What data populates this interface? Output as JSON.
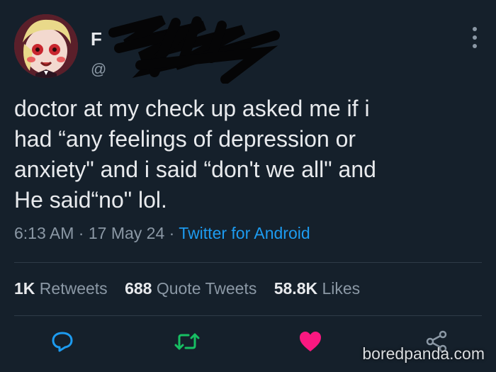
{
  "user": {
    "display_name": "F",
    "handle": "@"
  },
  "tweet": {
    "text": "doctor at my check up asked me if i\nhad “any feelings of depression or\nanxiety\" and i said “don't we all\" and\nHe said“no\" lol.",
    "time": "6:13 AM",
    "separator": "·",
    "date": "17 May 24",
    "source": "Twitter for Android"
  },
  "stats": {
    "retweets_count": "1K",
    "retweets_label": "Retweets",
    "quotes_count": "688",
    "quotes_label": "Quote Tweets",
    "likes_count": "58.8K",
    "likes_label": "Likes"
  },
  "colors": {
    "background": "#15202b",
    "accent": "#1d9bf0",
    "retweet": "#17bf63",
    "like": "#f91880",
    "muted": "#8b98a5"
  },
  "icons": {
    "reply": "reply-icon",
    "retweet": "retweet-icon",
    "like": "heart-icon",
    "share": "share-icon",
    "more": "more-icon"
  },
  "watermark": "boredpanda.com"
}
